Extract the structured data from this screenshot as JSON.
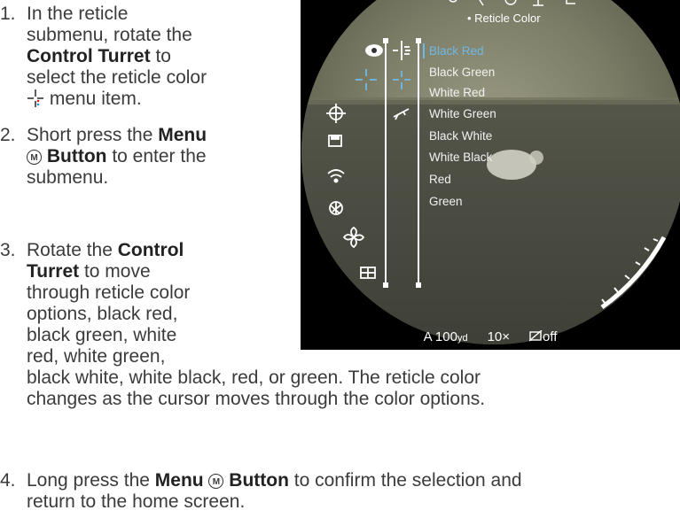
{
  "steps": [
    {
      "num": "1.",
      "lines": [
        [
          {
            "t": "In the reticle"
          }
        ],
        [
          {
            "t": "submenu, rotate the"
          }
        ],
        [
          {
            "t": "Control Turret",
            "b": true
          },
          {
            "t": " to"
          }
        ],
        [
          {
            "t": "select the reticle color"
          }
        ],
        [
          {
            "icon": "reticle-color-icon"
          },
          {
            "t": " menu item."
          }
        ]
      ]
    },
    {
      "num": "2.",
      "lines": [
        [
          {
            "t": "Short press the "
          },
          {
            "t": "Menu",
            "b": true
          }
        ],
        [
          {
            "icon": "menu-m-icon"
          },
          {
            "t": " "
          },
          {
            "t": "Button",
            "b": true
          },
          {
            "t": " to enter the"
          }
        ],
        [
          {
            "t": "submenu."
          }
        ]
      ]
    },
    {
      "num": "3.",
      "lines": [
        [
          {
            "t": "Rotate the "
          },
          {
            "t": "Control",
            "b": true
          }
        ],
        [
          {
            "t": "Turret",
            "b": true
          },
          {
            "t": " to move"
          }
        ],
        [
          {
            "t": "through reticle color"
          }
        ],
        [
          {
            "t": "options, black red,"
          }
        ],
        [
          {
            "t": "black green, white"
          }
        ],
        [
          {
            "t": "red, white green,"
          }
        ],
        [
          {
            "t": "black white, white black, red, or green. The reticle color"
          }
        ],
        [
          {
            "t": "changes as the cursor moves through the color options."
          }
        ]
      ]
    },
    {
      "num": "4.",
      "lines": [
        [
          {
            "t": "Long press the "
          },
          {
            "t": "Menu",
            "b": true
          },
          {
            "t": " "
          },
          {
            "icon": "menu-m-icon"
          },
          {
            "t": " "
          },
          {
            "t": "Button",
            "b": true
          },
          {
            "t": " to confirm the selection and"
          }
        ],
        [
          {
            "t": "return to the home screen."
          }
        ]
      ]
    }
  ],
  "device": {
    "menu_title": "• Reticle Color",
    "options": [
      "Black Red",
      "Black Green",
      "White Red",
      "White Green",
      "Black White",
      "White Black",
      "Red",
      "Green"
    ],
    "selected_index": 0,
    "selected_color": "#6fb8e6",
    "left_icons": [
      "eye-icon",
      "reticle-icon",
      "crosshair-icon",
      "save-icon",
      "wifi-icon",
      "aperture-icon",
      "fan-icon",
      "grid-icon"
    ],
    "sub_icons": [
      "reticle-style-icon",
      "reticle-color-icon",
      "rifle-icon"
    ],
    "status": {
      "distance": "A 100",
      "distance_unit": "yd",
      "zoom": "10×",
      "pip_state": "off"
    }
  }
}
